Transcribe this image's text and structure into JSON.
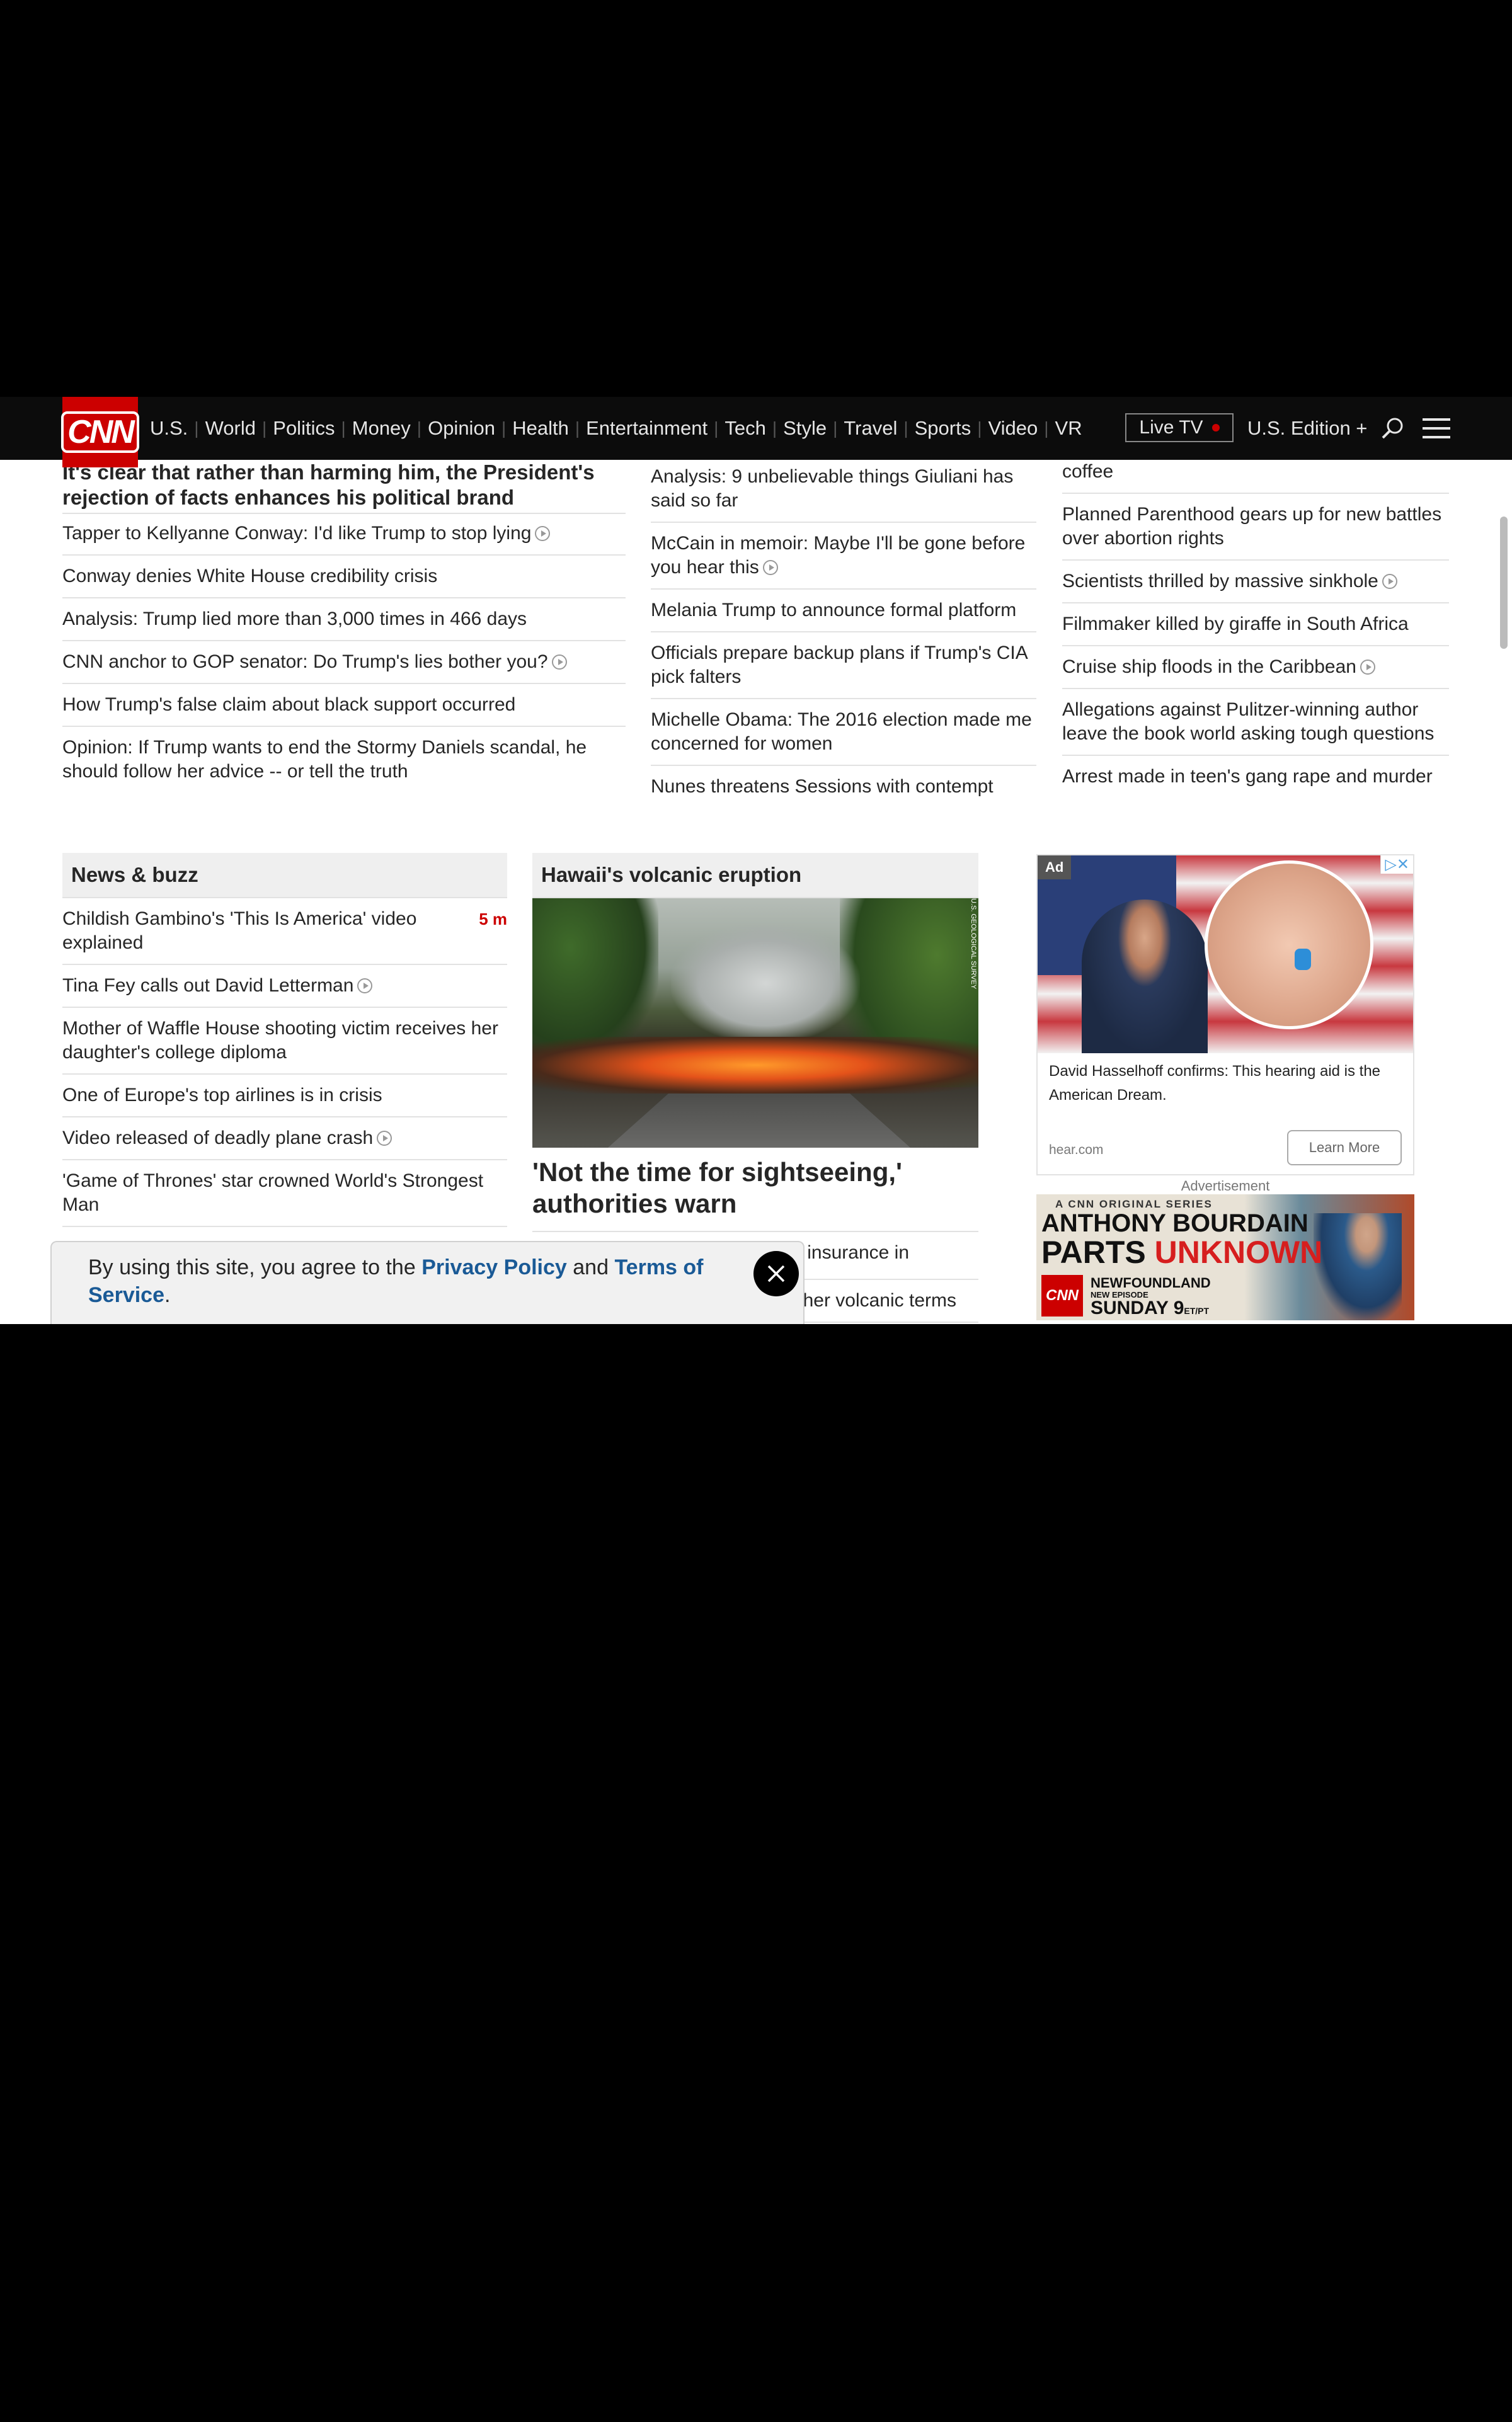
{
  "nav": {
    "logo": "CNN",
    "links": [
      "U.S.",
      "World",
      "Politics",
      "Money",
      "Opinion",
      "Health",
      "Entertainment",
      "Tech",
      "Style",
      "Travel",
      "Sports",
      "Video",
      "VR"
    ],
    "live_tv": "Live TV",
    "edition": "U.S. Edition +"
  },
  "col1": {
    "lead": "It's clear that rather than harming him, the President's rejection of facts enhances his political brand",
    "items": [
      "Tapper to Kellyanne Conway: I'd like Trump to stop lying",
      "Conway denies White House credibility crisis",
      "Analysis: Trump lied more than 3,000 times in 466 days",
      "CNN anchor to GOP senator: Do Trump's lies bother you?",
      "How Trump's false claim about black support occurred",
      "Opinion: If Trump wants to end the Stormy Daniels scandal, he should follow her advice -- or tell the truth"
    ]
  },
  "col2": {
    "items": [
      "Analysis: 9 unbelievable things Giuliani has said so far",
      "McCain in memoir: Maybe I'll be gone before you hear this",
      "Melania Trump to announce formal platform",
      "Officials prepare backup plans if Trump's CIA pick falters",
      "Michelle Obama: The 2016 election made me concerned for women",
      "Nunes threatens Sessions with contempt"
    ]
  },
  "col3": {
    "items": [
      "coffee",
      "Planned Parenthood gears up for new battles over abortion rights",
      "Scientists thrilled by massive sinkhole",
      "Filmmaker killed by giraffe in South Africa",
      "Cruise ship floods in the Caribbean",
      "Allegations against Pulitzer-winning author leave the book world asking tough questions",
      "Arrest made in teen's gang rape and murder"
    ]
  },
  "news_buzz": {
    "title": "News & buzz",
    "first_time": "5 m",
    "items": [
      "Childish Gambino's 'This Is America' video explained",
      "Tina Fey calls out David Letterman",
      "Mother of Waffle House shooting victim receives her daughter's college diploma",
      "One of Europe's top airlines is in crisis",
      "Video released of deadly plane crash",
      "'Game of Thrones' star crowned World's Strongest Man"
    ]
  },
  "hawaii": {
    "title": "Hawaii's volcanic eruption",
    "photo_credit": "U.S. GEOLOGICAL SURVEY",
    "headline": "'Not the time for sightseeing,' authorities warn",
    "items_partial": [
      "insurance in",
      "her volcanic terms"
    ]
  },
  "ad1": {
    "tag": "Ad",
    "choices": "▷✕",
    "text": "David Hasselhoff confirms: This hearing aid is the American Dream.",
    "domain": "hear.com",
    "cta": "Learn More",
    "label": "Advertisement"
  },
  "ad2": {
    "series": "A CNN ORIGINAL SERIES",
    "name_line1": "ANTHONY BOURDAIN",
    "name_parts": "PARTS",
    "name_unknown": "UNKNOWN",
    "cnn": "CNN",
    "location": "NEWFOUNDLAND",
    "episode": "NEW EPISODE",
    "day": "SUNDAY 9",
    "time_suffix": "ET/PT"
  },
  "cookie": {
    "prefix": "By using this site, you agree to the ",
    "privacy": "Privacy Policy",
    "and": " and ",
    "terms": "Terms of Service",
    "suffix": "."
  }
}
